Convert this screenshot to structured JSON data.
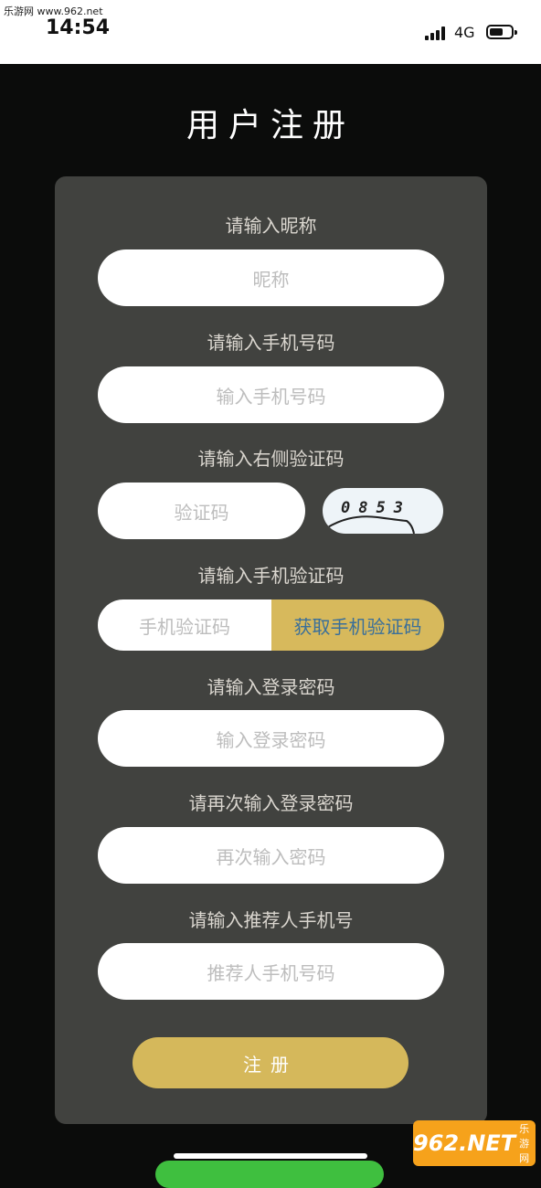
{
  "status_bar": {
    "watermark": "乐游网 www.962.net",
    "time": "14:54",
    "network": "4G"
  },
  "page": {
    "title": "用户注册"
  },
  "form": {
    "nickname": {
      "label": "请输入昵称",
      "placeholder": "昵称"
    },
    "phone": {
      "label": "请输入手机号码",
      "placeholder": "输入手机号码"
    },
    "captcha": {
      "label": "请输入右侧验证码",
      "placeholder": "验证码",
      "image_text": "0853"
    },
    "sms": {
      "label": "请输入手机验证码",
      "placeholder": "手机验证码",
      "button": "获取手机验证码"
    },
    "password": {
      "label": "请输入登录密码",
      "placeholder": "输入登录密码"
    },
    "password_confirm": {
      "label": "请再次输入登录密码",
      "placeholder": "再次输入密码"
    },
    "referrer": {
      "label": "请输入推荐人手机号",
      "placeholder": "推荐人手机号码"
    },
    "submit": "注册"
  },
  "watermark_logo": {
    "number": "962",
    "suffix": ".NET",
    "text": "乐游网"
  },
  "colors": {
    "panel": "#41423f",
    "accent": "#d7b95c",
    "link": "#3a6f9a"
  }
}
